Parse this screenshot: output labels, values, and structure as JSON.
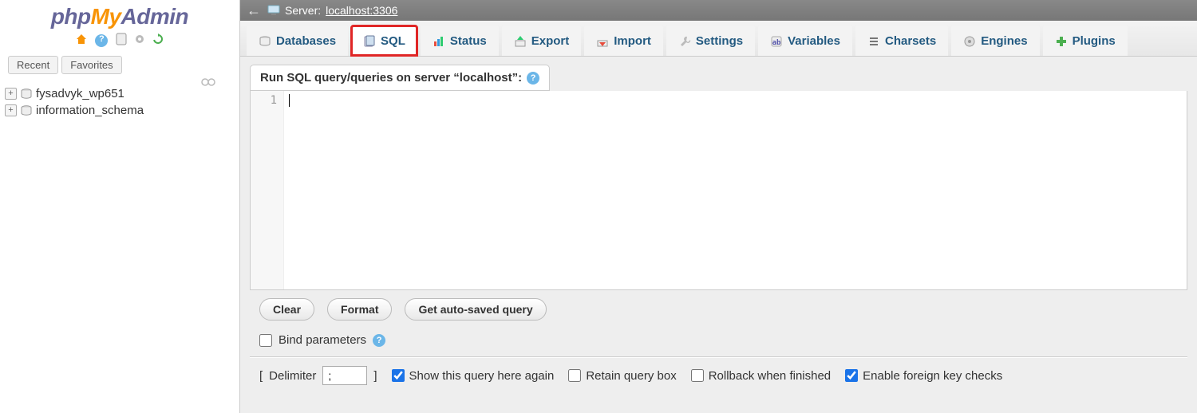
{
  "logo": {
    "part1": "php",
    "part2": "My",
    "part3": "Admin"
  },
  "sidebar": {
    "recent_label": "Recent",
    "favorites_label": "Favorites",
    "databases": [
      {
        "name": "fysadvyk_wp651"
      },
      {
        "name": "information_schema"
      }
    ]
  },
  "topbar": {
    "server_prefix": "Server:",
    "server_value": "localhost:3306"
  },
  "tabs": [
    {
      "key": "databases",
      "label": "Databases"
    },
    {
      "key": "sql",
      "label": "SQL"
    },
    {
      "key": "status",
      "label": "Status"
    },
    {
      "key": "export",
      "label": "Export"
    },
    {
      "key": "import",
      "label": "Import"
    },
    {
      "key": "settings",
      "label": "Settings"
    },
    {
      "key": "variables",
      "label": "Variables"
    },
    {
      "key": "charsets",
      "label": "Charsets"
    },
    {
      "key": "engines",
      "label": "Engines"
    },
    {
      "key": "plugins",
      "label": "Plugins"
    }
  ],
  "sql_panel": {
    "heading": "Run SQL query/queries on server “localhost”:",
    "line_number": "1",
    "buttons": {
      "clear": "Clear",
      "format": "Format",
      "get_autosaved": "Get auto-saved query"
    },
    "bind_params_label": "Bind parameters"
  },
  "bottom": {
    "delimiter_label": "Delimiter",
    "delimiter_value": ";",
    "bracket_open": "[",
    "bracket_close": "]",
    "opt_show_again": "Show this query here again",
    "opt_retain": "Retain query box",
    "opt_rollback": "Rollback when finished",
    "opt_fk": "Enable foreign key checks"
  }
}
